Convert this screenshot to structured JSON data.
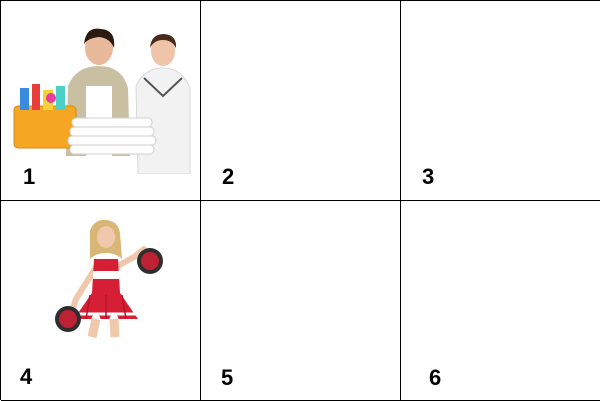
{
  "grid": {
    "cells": [
      {
        "number": "1",
        "image": "cleaning-staff-photo"
      },
      {
        "number": "2",
        "image": null
      },
      {
        "number": "3",
        "image": null
      },
      {
        "number": "4",
        "image": "cheerleader-photo"
      },
      {
        "number": "5",
        "image": null
      },
      {
        "number": "6",
        "image": null
      }
    ]
  },
  "colors": {
    "grid_lines": "#000000",
    "cheer_red": "#d61f35",
    "basket_orange": "#f5a623"
  }
}
